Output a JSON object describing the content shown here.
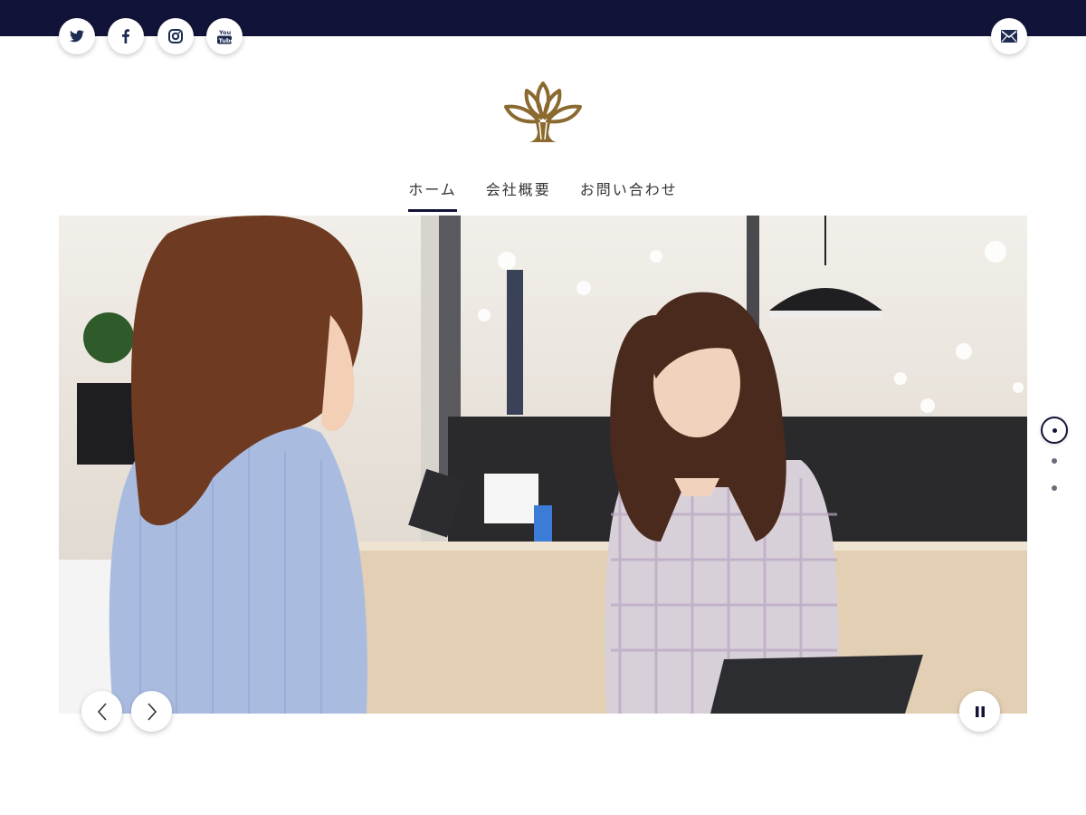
{
  "header": {
    "social": [
      {
        "icon": "twitter-icon",
        "label": "Twitter"
      },
      {
        "icon": "facebook-icon",
        "label": "Facebook"
      },
      {
        "icon": "instagram-icon",
        "label": "Instagram"
      },
      {
        "icon": "youtube-icon",
        "label": "YouTube"
      }
    ],
    "mail_icon": "mail-icon",
    "colors": {
      "topbar": "#121338",
      "logo": "#8b6a30"
    }
  },
  "nav": {
    "items": [
      {
        "label": "ホーム",
        "active": true
      },
      {
        "label": "会社概要",
        "active": false
      },
      {
        "label": "お問い合わせ",
        "active": false
      }
    ]
  },
  "slider": {
    "current_slide": 1,
    "slide_count": 3,
    "prev_icon": "chevron-left-icon",
    "next_icon": "chevron-right-icon",
    "pause_icon": "pause-icon"
  }
}
